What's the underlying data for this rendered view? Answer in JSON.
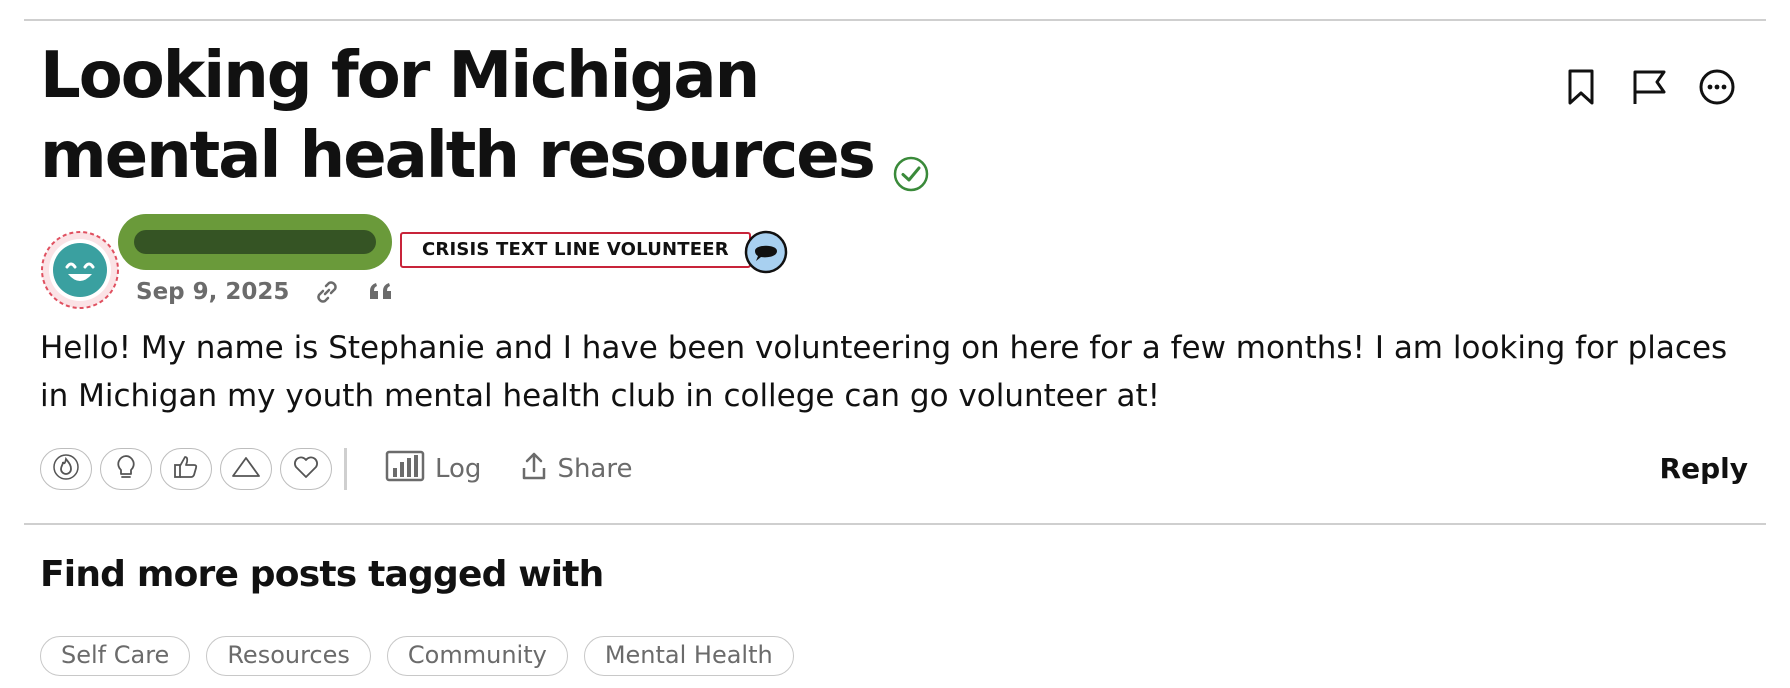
{
  "post": {
    "title": "Looking for Michigan mental health resources",
    "author_badge": "CRISIS TEXT LINE VOLUNTEER",
    "date": "Sep 9, 2025",
    "body": "Hello! My name is Stephanie and I have been volunteering on here for a few months! I am looking for places in Michigan my youth mental health club in college can go volunteer at!"
  },
  "actions": {
    "log_label": "Log",
    "share_label": "Share",
    "reply_label": "Reply"
  },
  "tags_section": {
    "heading": "Find more posts tagged with",
    "tags": [
      "Self Care",
      "Resources",
      "Community",
      "Mental Health"
    ]
  },
  "icons": {
    "header": [
      "bookmark-icon",
      "flag-icon",
      "more-options-icon"
    ],
    "meta": [
      "link-icon",
      "quote-icon"
    ],
    "reactions": [
      "fire-icon",
      "lightbulb-icon",
      "thumbs-up-icon",
      "upvote-triangle-icon",
      "heart-icon"
    ]
  },
  "colors": {
    "name_pill": "#6a9a3a",
    "badge_border": "#c8243a",
    "verified": "#3a8a3a",
    "avatar_ring": "#e05060",
    "avatar_face": "#3aa0a0",
    "chat_badge": "#a8d0f0"
  }
}
